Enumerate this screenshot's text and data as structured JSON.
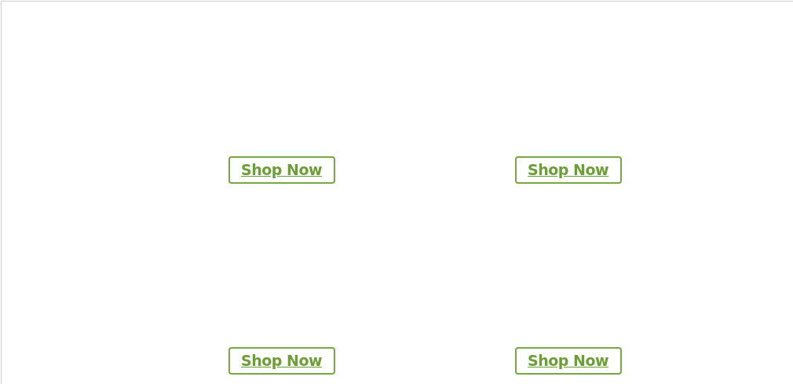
{
  "products": [
    {
      "button": "Shop Now"
    },
    {
      "button": "Shop Now"
    },
    {
      "button": "Shop Now"
    },
    {
      "button": "Shop Now"
    }
  ]
}
